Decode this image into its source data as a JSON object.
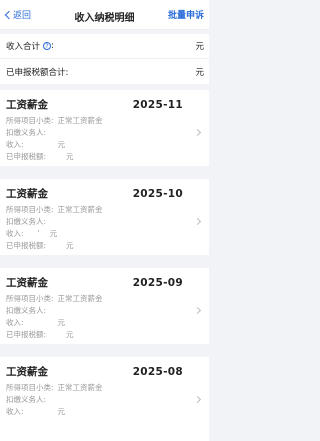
{
  "header": {
    "back_label": "返回",
    "title": "收入纳税明细",
    "batch_label": "批量申诉"
  },
  "summary": {
    "income_total_label": "收入合计",
    "income_total_value": "元",
    "tax_total_label": "已申报税额合计:",
    "tax_total_value": "元"
  },
  "labels": {
    "category": "所得项目小类:",
    "withholder": "扣缴义务人:",
    "income": "收入:",
    "tax": "已申报税额:",
    "unit": "元"
  },
  "cards": [
    {
      "title": "工资薪金",
      "month": "2025-11",
      "category": "正常工资薪金",
      "income_mark": ""
    },
    {
      "title": "工资薪金",
      "month": "2025-10",
      "category": "正常工资薪金",
      "income_mark": "'"
    },
    {
      "title": "工资薪金",
      "month": "2025-09",
      "category": "正常工资薪金",
      "income_mark": ""
    },
    {
      "title": "工资薪金",
      "month": "2025-08",
      "category": "正常工资薪金",
      "income_mark": ""
    }
  ]
}
